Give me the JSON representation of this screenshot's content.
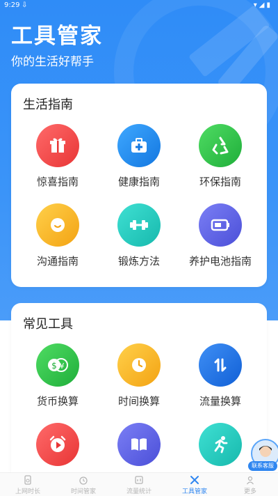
{
  "status_bar": {
    "time": "9:29"
  },
  "header": {
    "title": "工具管家",
    "subtitle": "你的生活好帮手"
  },
  "section_life": {
    "title": "生活指南",
    "items": [
      {
        "label": "惊喜指南",
        "icon": "gift-icon",
        "color": "#f24848"
      },
      {
        "label": "健康指南",
        "icon": "medical-kit-icon",
        "color": "#1c8ff1"
      },
      {
        "label": "环保指南",
        "icon": "recycle-icon",
        "color": "#28c04a"
      },
      {
        "label": "沟通指南",
        "icon": "chat-bubble-icon",
        "color": "#f9b52a"
      },
      {
        "label": "锻炼方法",
        "icon": "dumbbell-icon",
        "color": "#22ccc0"
      },
      {
        "label": "养护电池指南",
        "icon": "battery-icon",
        "color": "#5b5fe6"
      }
    ]
  },
  "section_tools": {
    "title": "常见工具",
    "items": [
      {
        "label": "货币换算",
        "icon": "currency-exchange-icon",
        "color": "#28c04a"
      },
      {
        "label": "时间换算",
        "icon": "clock-icon",
        "color": "#f9b52a"
      },
      {
        "label": "流量换算",
        "icon": "swap-arrows-icon",
        "color": "#1c7ee8"
      },
      {
        "label": "",
        "icon": "alarm-play-icon",
        "color": "#f24848"
      },
      {
        "label": "",
        "icon": "book-icon",
        "color": "#5b5fe6"
      },
      {
        "label": "",
        "icon": "running-icon",
        "color": "#22ccc0"
      }
    ]
  },
  "customer_service": {
    "label": "联系客服"
  },
  "tabbar": {
    "tabs": [
      {
        "label": "上网时长",
        "icon": "phone-time-icon"
      },
      {
        "label": "时间管家",
        "icon": "alarm-icon"
      },
      {
        "label": "流量统计",
        "icon": "data-stats-icon"
      },
      {
        "label": "工具管家",
        "icon": "tools-icon",
        "active": true
      },
      {
        "label": "更多",
        "icon": "person-icon"
      }
    ]
  }
}
